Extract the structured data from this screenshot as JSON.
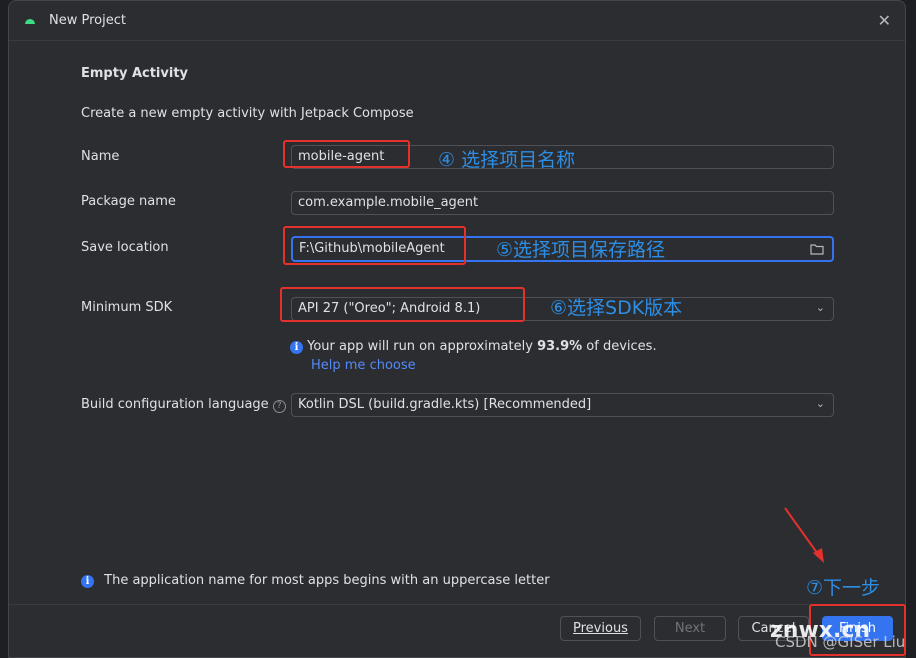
{
  "window": {
    "title": "New Project",
    "close_icon": "close-icon",
    "app_icon": "android-icon"
  },
  "header": {
    "heading": "Empty Activity",
    "description": "Create a new empty activity with Jetpack Compose"
  },
  "form": {
    "name": {
      "label": "Name",
      "value": "mobile-agent"
    },
    "package": {
      "label": "Package name",
      "value": "com.example.mobile_agent"
    },
    "location": {
      "label": "Save location",
      "value": "F:\\Github\\mobileAgent",
      "icon": "folder-icon"
    },
    "min_sdk": {
      "label": "Minimum SDK",
      "value": "API 27 (\"Oreo\"; Android 8.1)"
    },
    "sdk_info": {
      "prefix": "Your app will run on approximately ",
      "percent": "93.9%",
      "suffix": " of devices.",
      "link": "Help me choose"
    },
    "build_lang": {
      "label": "Build configuration language",
      "value": "Kotlin DSL (build.gradle.kts) [Recommended]"
    }
  },
  "footer_info": "The application name for most apps begins with an uppercase letter",
  "buttons": {
    "previous": "Previous",
    "next": "Next",
    "cancel": "Cancel",
    "finish": "Finish"
  },
  "annotations": {
    "a4": "④ 选择项目名称",
    "a5": "⑤选择项目保存路径",
    "a6": "⑥选择SDK版本",
    "a7": "⑦下一步"
  },
  "watermark": {
    "w1": "znwx.cn",
    "w2": "CSDN @GISer Liu"
  },
  "colors": {
    "accent": "#3574f0",
    "annotation": "#2d8ee6",
    "highlight": "#e5312b"
  }
}
